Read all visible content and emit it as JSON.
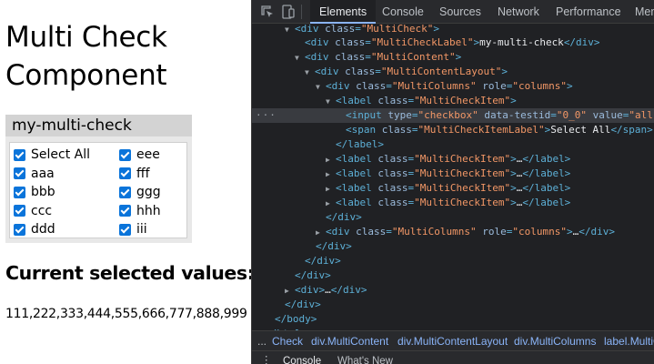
{
  "page": {
    "heading": "Multi Check Component",
    "multicheck": {
      "label": "my-multi-check",
      "column1": [
        "Select All",
        "aaa",
        "bbb",
        "ccc",
        "ddd"
      ],
      "column2": [
        "eee",
        "fff",
        "ggg",
        "hhh",
        "iii"
      ]
    },
    "subheading": "Current selected values:",
    "values": "111,222,333,444,555,666,777,888,999"
  },
  "devtools": {
    "tabs": [
      "Elements",
      "Console",
      "Sources",
      "Network",
      "Performance",
      "Memory"
    ],
    "active_tab": "Elements",
    "breadcrumbs": {
      "lead": "...",
      "items": [
        "Check",
        "div.MultiContent",
        "div.MultiContentLayout",
        "div.MultiColumns",
        "label.MultiC"
      ]
    },
    "drawer": {
      "tabs": [
        "Console",
        "What's New"
      ]
    }
  }
}
